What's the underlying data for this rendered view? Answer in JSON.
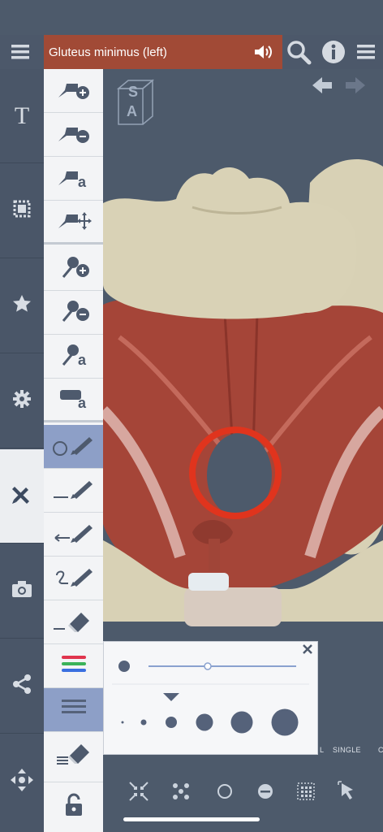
{
  "header": {
    "title": "Gluteus minimus (left)"
  },
  "left_rail": {
    "items": [
      {
        "name": "text-tool",
        "label": "T"
      },
      {
        "name": "frame-icon"
      },
      {
        "name": "star-icon"
      },
      {
        "name": "gear-icon"
      },
      {
        "name": "pencil-ruler-icon",
        "active": true
      },
      {
        "name": "camera-icon"
      },
      {
        "name": "share-icon"
      },
      {
        "name": "move-icon"
      }
    ]
  },
  "tools": [
    "add-pin-icon",
    "remove-pin-icon",
    "pin-label-icon",
    "move-pin-icon",
    "add-pushpin-icon",
    "remove-pushpin-icon",
    "pushpin-label-icon",
    "label-icon",
    "draw-circle-icon",
    "draw-line-icon",
    "draw-arrow-icon",
    "draw-freehand-icon",
    "eraser-icon",
    "color-icon",
    "thickness-icon",
    "clear-drawing-icon",
    "lock-icon"
  ],
  "cube": {
    "top": "S",
    "front": "A"
  },
  "bottom_bar": {
    "labels": [
      "L",
      "SINGLE",
      "C"
    ]
  },
  "colors": {
    "title_bg": "#a14a36",
    "accent": "#e0341d",
    "selected_tool": "#8d9fc7"
  }
}
